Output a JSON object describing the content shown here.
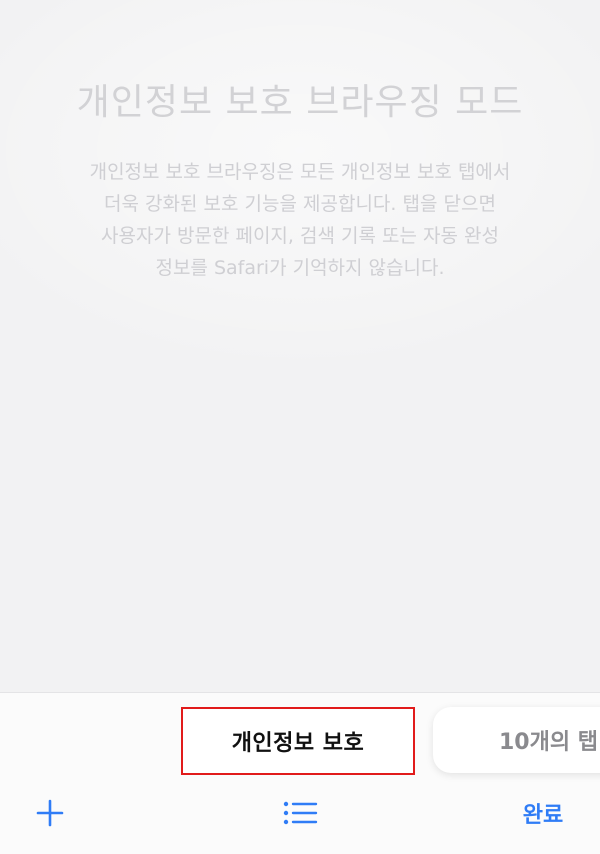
{
  "empty_state": {
    "title": "개인정보 보호 브라우징 모드",
    "description_lines": [
      "개인정보 보호 브라우징은 모든 개인정보 보호 탭에서",
      "더욱 강화된 보호 기능을 제공합니다. 탭을 닫으면",
      "사용자가 방문한 페이지, 검색 기록 또는 자동 완성",
      "정보를 Safari가 기억하지 않습니다."
    ]
  },
  "tab_group_switcher": {
    "active_label": "개인정보 보호",
    "next_label": "10개의 탭"
  },
  "toolbar": {
    "new_tab_icon": "plus-icon",
    "tab_groups_icon": "list-icon",
    "done_label": "완료"
  },
  "colors": {
    "accent": "#2f7cf6",
    "highlight_border": "#e11b1b",
    "background": "#f2f2f3",
    "muted_text": "#d2d2d5"
  }
}
